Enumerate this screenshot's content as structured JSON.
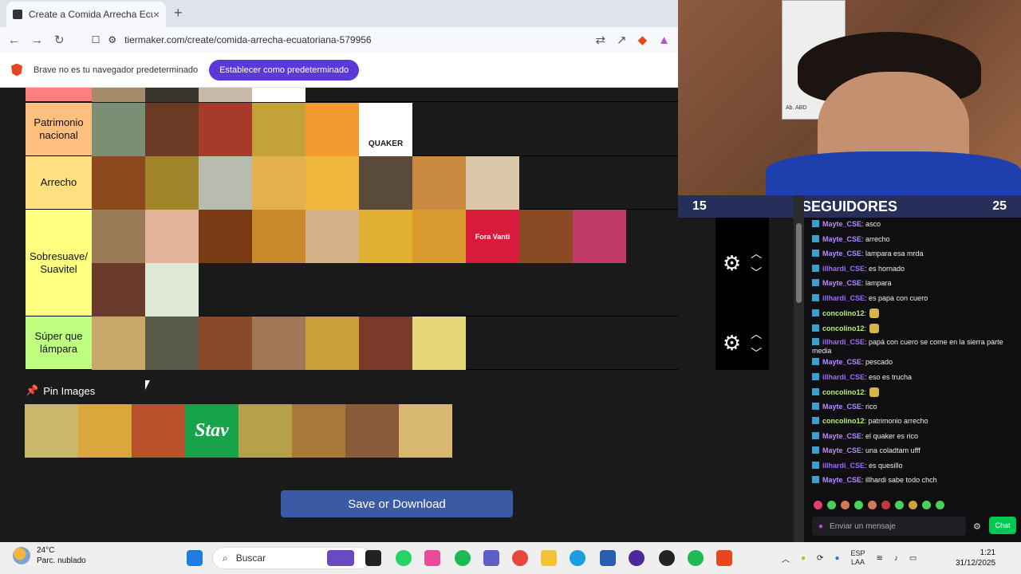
{
  "browser": {
    "tab_title": "Create a Comida Arrecha Ecuatoriana",
    "new_tab": "+",
    "close": "×",
    "url": "tiermaker.com/create/comida-arrecha-ecuatoriana-579956",
    "infobar_text": "Brave no es tu navegador predeterminado",
    "set_default": "Establecer como predeterminado"
  },
  "tiers": [
    {
      "label": "Patrimonio nacional",
      "color": "#ffbf7f",
      "items": 6,
      "quaker": "QUAKER"
    },
    {
      "label": "Arrecho",
      "color": "#ffdf80",
      "items": 8
    },
    {
      "label": "Sobresuave/ Suavitel",
      "color": "#ffff7f",
      "items": 12,
      "fora": "Fora Vanti"
    },
    {
      "label": "Súper que lámpara",
      "color": "#bfff7f",
      "items": 7
    }
  ],
  "pin": {
    "title": "Pin Images",
    "stav": "Stav"
  },
  "save_button": "Save or Download",
  "followers": {
    "left": "15",
    "title": "SEGUIDORES",
    "right": "25"
  },
  "chat": {
    "messages": [
      {
        "user": "Mayte_CSE",
        "color": "#b88cff",
        "text": ": asco"
      },
      {
        "user": "Mayte_CSE",
        "color": "#b88cff",
        "text": ": arrecho"
      },
      {
        "user": "Mayte_CSE",
        "color": "#b88cff",
        "text": ": lampara esa mrda"
      },
      {
        "user": "illhardi_CSE",
        "color": "#9a6bff",
        "text": ": es hornado"
      },
      {
        "user": "Mayte_CSE",
        "color": "#b88cff",
        "text": ": lampara"
      },
      {
        "user": "illhardi_CSE",
        "color": "#9a6bff",
        "text": ": es papa con cuero"
      },
      {
        "user": "concolino12",
        "color": "#b4f070",
        "text": ":",
        "emote": true
      },
      {
        "user": "concolino12",
        "color": "#b4f070",
        "text": ":",
        "emote": true
      },
      {
        "user": "illhardi_CSE",
        "color": "#9a6bff",
        "text": ": papá con cuero se come en la sierra parte media"
      },
      {
        "user": "Mayte_CSE",
        "color": "#b88cff",
        "text": ": pescado"
      },
      {
        "user": "illhardi_CSE",
        "color": "#9a6bff",
        "text": ": eso es trucha"
      },
      {
        "user": "concolino12",
        "color": "#b4f070",
        "text": ":",
        "emote": true
      },
      {
        "user": "Mayte_CSE",
        "color": "#b88cff",
        "text": ": rico"
      },
      {
        "user": "concolino12",
        "color": "#b4f070",
        "text": ": patrimonio arrecho"
      },
      {
        "user": "Mayte_CSE",
        "color": "#b88cff",
        "text": ": el quaker es rico"
      },
      {
        "user": "Mayte_CSE",
        "color": "#b88cff",
        "text": ": una coladtam ufff"
      },
      {
        "user": "illhardi_CSE",
        "color": "#9a6bff",
        "text": ": es quesillo"
      },
      {
        "user": "Mayte_CSE",
        "color": "#b88cff",
        "text": ": illhardi sabe todo chch"
      }
    ],
    "input_placeholder": "Enviar un mensaje",
    "chat_button": "Chat"
  },
  "taskbar": {
    "temp": "24°C",
    "weather": "Parc. nublado",
    "search": "Buscar",
    "lang1": "ESP",
    "lang2": "LAA",
    "time": "1:21",
    "date": "31/12/2025"
  },
  "poster_text": "Ab. ABD"
}
